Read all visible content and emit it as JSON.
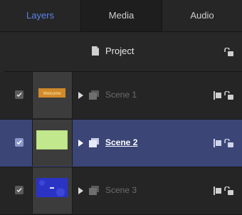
{
  "tabs": [
    {
      "label": "Layers",
      "active": true
    },
    {
      "label": "Media",
      "active": false
    },
    {
      "label": "Audio",
      "active": false
    }
  ],
  "project": {
    "label": "Project",
    "icon": "document-icon",
    "lock_icon": "unlock-icon"
  },
  "scenes": [
    {
      "label": "Scene 1",
      "checked": true,
      "selected": false,
      "thumb_text": "Welcome"
    },
    {
      "label": "Scene 2",
      "checked": true,
      "selected": true,
      "thumb_text": ""
    },
    {
      "label": "Scene 3",
      "checked": true,
      "selected": false,
      "thumb_text": ""
    }
  ],
  "colors": {
    "accent": "#5a83e8",
    "selected_row": "#3b4677",
    "panel_bg": "#252525"
  }
}
